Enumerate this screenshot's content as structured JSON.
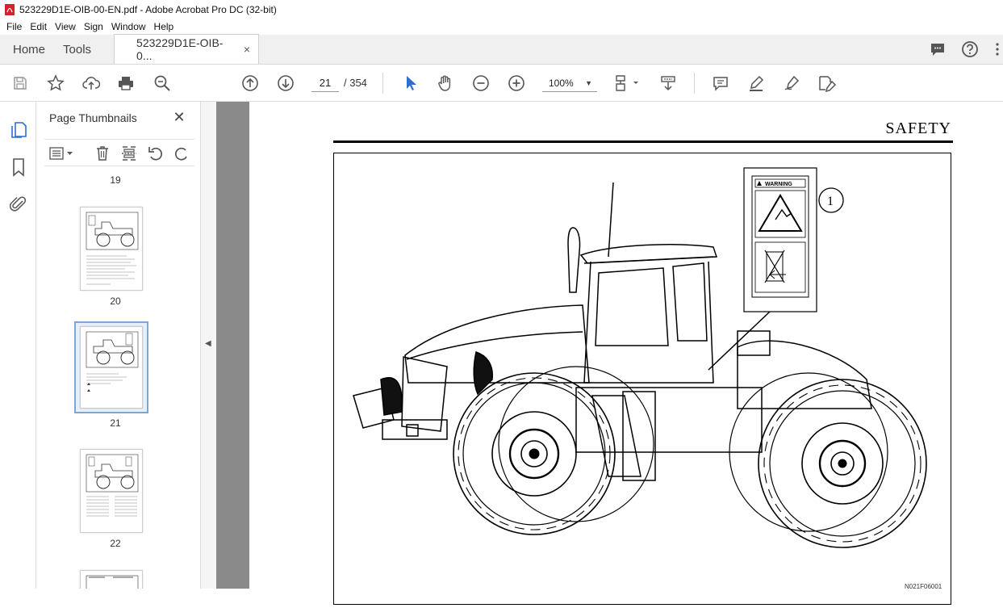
{
  "window": {
    "title": "523229D1E-OIB-00-EN.pdf - Adobe Acrobat Pro DC (32-bit)"
  },
  "menu": [
    "File",
    "Edit",
    "View",
    "Sign",
    "Window",
    "Help"
  ],
  "tabs": {
    "home": "Home",
    "tools": "Tools",
    "document": "523229D1E-OIB-0...",
    "close_symbol": "×"
  },
  "toolbar": {
    "current_page": "21",
    "page_total": "/ 354",
    "zoom": "100%"
  },
  "panel": {
    "title": "Page Thumbnails",
    "close_symbol": "✕",
    "thumbnails": [
      {
        "label": "19"
      },
      {
        "label": "20"
      },
      {
        "label": "21",
        "selected": true
      },
      {
        "label": "22"
      }
    ]
  },
  "document": {
    "section_header": "SAFETY",
    "callout_number": "1",
    "warning_label": "WARNING",
    "figure_code": "N021F06001"
  },
  "colors": {
    "accent_blue": "#2c6fd1",
    "selection_border": "#7aa7d6",
    "doc_background": "#8a8a8a",
    "acrobat_red": "#d4212b"
  }
}
